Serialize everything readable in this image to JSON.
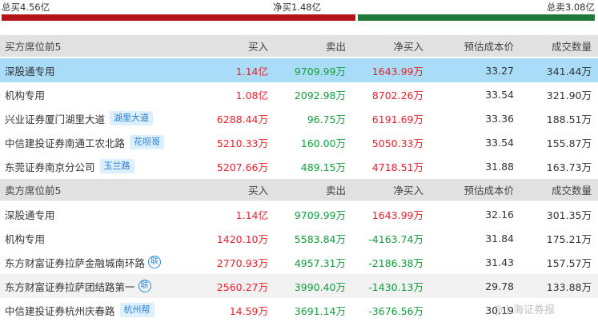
{
  "summary": {
    "total_buy": "总买4.56亿",
    "net_buy": "净买1.48亿",
    "total_sell": "总卖3.08亿"
  },
  "buy_section": {
    "headers": [
      "买方席位前5",
      "买入",
      "卖出",
      "净买入",
      "预估成本价",
      "成交数量"
    ],
    "rows": [
      {
        "name": "深股通专用",
        "tag": "",
        "lian": false,
        "buy": "1.14亿",
        "sell": "9709.99万",
        "net": "1643.99万",
        "cost": "33.27",
        "volume": "341.44万"
      },
      {
        "name": "机构专用",
        "tag": "",
        "lian": false,
        "buy": "1.08亿",
        "sell": "2092.98万",
        "net": "8702.26万",
        "cost": "33.54",
        "volume": "321.90万"
      },
      {
        "name": "兴业证券厦门湖里大道",
        "tag": "湖里大道",
        "lian": false,
        "buy": "6288.44万",
        "sell": "96.75万",
        "net": "6191.69万",
        "cost": "33.36",
        "volume": "188.51万"
      },
      {
        "name": "中信建投证券南通工农北路",
        "tag": "花呗哥",
        "lian": false,
        "buy": "5210.33万",
        "sell": "160.00万",
        "net": "5050.33万",
        "cost": "33.54",
        "volume": "155.87万"
      },
      {
        "name": "东莞证券南京分公司",
        "tag": "玉兰路",
        "lian": false,
        "buy": "5207.66万",
        "sell": "489.15万",
        "net": "4718.51万",
        "cost": "31.88",
        "volume": "163.73万"
      }
    ]
  },
  "sell_section": {
    "headers": [
      "卖方席位前5",
      "买入",
      "卖出",
      "净买入",
      "预估成本价",
      "成交数量"
    ],
    "rows": [
      {
        "name": "深股通专用",
        "tag": "",
        "lian": false,
        "buy": "1.14亿",
        "sell": "9709.99万",
        "net": "1643.99万",
        "cost": "32.16",
        "volume": "301.35万"
      },
      {
        "name": "机构专用",
        "tag": "",
        "lian": false,
        "buy": "1420.10万",
        "sell": "5583.84万",
        "net": "-4163.74万",
        "cost": "31.84",
        "volume": "175.21万"
      },
      {
        "name": "东方财富证券拉萨金融城南环路",
        "tag": "",
        "lian": true,
        "buy": "2770.93万",
        "sell": "4957.31万",
        "net": "-2186.38万",
        "cost": "31.43",
        "volume": "157.57万"
      },
      {
        "name": "东方财富证券拉萨团结路第一",
        "tag": "",
        "lian": true,
        "buy": "2560.27万",
        "sell": "3990.40万",
        "net": "-1430.13万",
        "cost": "29.78",
        "volume": "133.88万"
      },
      {
        "name": "中信建投证券杭州庆春路",
        "tag": "杭州帮",
        "lian": false,
        "buy": "14.59万",
        "sell": "3691.14万",
        "net": "-3676.56万",
        "cost": "30.19",
        "volume": ""
      }
    ]
  },
  "lian_glyph": "联",
  "watermark": "@上海证券报",
  "colors": {
    "buy_bar": "#b5141a",
    "sell_bar": "#1f7a3a",
    "highlight_row": "#a8dcf7",
    "header_bg": "#e1e1e1",
    "positive": "#e8222a",
    "negative": "#149c3c",
    "tag": "#2a7fd0"
  }
}
